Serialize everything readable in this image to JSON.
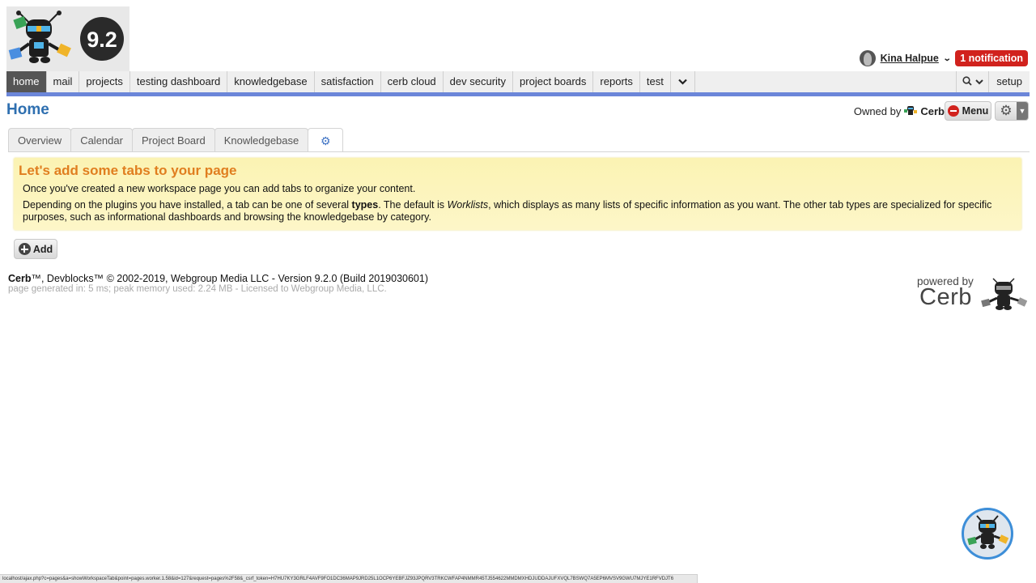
{
  "app": {
    "version_badge": "9.2"
  },
  "user": {
    "name": "Kina Halpue",
    "notifications": "1 notification"
  },
  "nav": {
    "items": [
      {
        "label": "home",
        "active": true
      },
      {
        "label": "mail"
      },
      {
        "label": "projects"
      },
      {
        "label": "testing dashboard"
      },
      {
        "label": "knowledgebase"
      },
      {
        "label": "satisfaction"
      },
      {
        "label": "cerb cloud"
      },
      {
        "label": "dev security"
      },
      {
        "label": "project boards"
      },
      {
        "label": "reports"
      },
      {
        "label": "test"
      }
    ],
    "setup_label": "setup"
  },
  "page": {
    "title": "Home",
    "owned_by_label": "Owned by",
    "owner": "Cerb",
    "menu_label": "Menu"
  },
  "tabs": [
    {
      "label": "Overview"
    },
    {
      "label": "Calendar"
    },
    {
      "label": "Project Board"
    },
    {
      "label": "Knowledgebase"
    }
  ],
  "help": {
    "title": "Let's add some tabs to your page",
    "line1": "Once you've created a new workspace page you can add tabs to organize your content.",
    "line2_a": "Depending on the plugins you have installed, a tab can be one of several ",
    "line2_b": "types",
    "line2_c": ". The default is ",
    "line2_d": "Worklists",
    "line2_e": ", which displays as many lists of specific information as you want. The other tab types are specialized for specific purposes, such as informational dashboards and browsing the knowledgebase by category."
  },
  "add_label": "Add",
  "footer": {
    "brand": "Cerb",
    "line1_rest": "™, Devblocks™ © 2002-2019, Webgroup Media LLC - Version 9.2.0 (Build 2019030601)",
    "line2": "page generated in: 5 ms; peak memory used: 2.24 MB - Licensed to Webgroup Media, LLC.",
    "powered_by": "powered by",
    "powered_brand": "Cerb"
  },
  "status_url": "localhost/ajax.php?c=pages&a=showWorkspaceTab&point=pages.worker.1.58&id=127&request=pages%2F58&_csrf_token=H7HU7KY3GRLF4AVF9FO1DC36MAP9JRD25L1OCP6YEBFJZ93JPQRV3TRKCWFAP4NMMR45TJ554622MMDMXHDJUDDAJUFXVQL7BSWQ7A5EP6MVSV9GWU7MJYE1RFVDJT6"
}
